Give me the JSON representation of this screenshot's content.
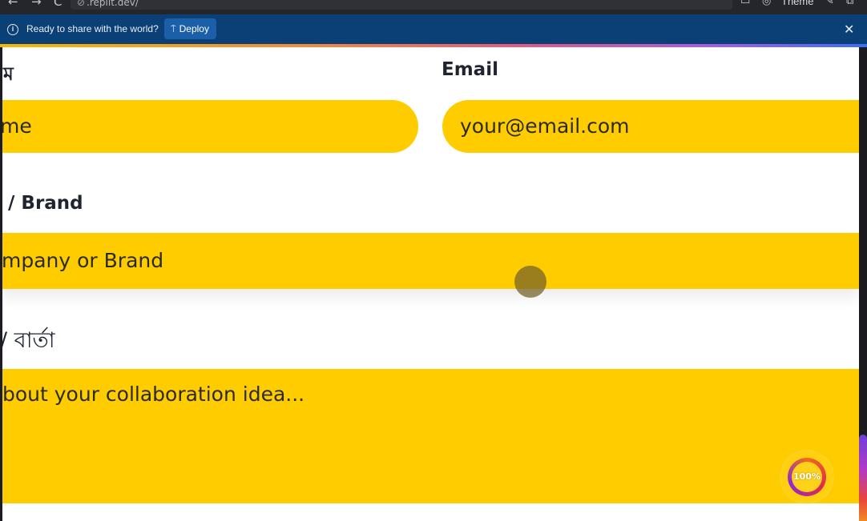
{
  "browser": {
    "back_glyph": "←",
    "forward_glyph": "→",
    "reload_glyph": "C",
    "url": ".replit.dev/",
    "theme_label": "Theme"
  },
  "banner": {
    "message": "Ready to share with the world?",
    "deploy_label": "Deploy",
    "close_glyph": "✕"
  },
  "form": {
    "name_label": "ম",
    "name_placeholder": "me",
    "email_label": "Email",
    "email_placeholder": "your@email.com",
    "company_label": "/ Brand",
    "company_placeholder": "mpany or Brand",
    "message_label": "/ বার্তা",
    "message_placeholder": "bout your collaboration idea..."
  },
  "progress": {
    "label": "100%",
    "value": 1.0
  },
  "colors": {
    "field_bg": "#ffcc00",
    "banner_bg": "#0a4076",
    "deploy_bg": "#1a5fa8"
  }
}
